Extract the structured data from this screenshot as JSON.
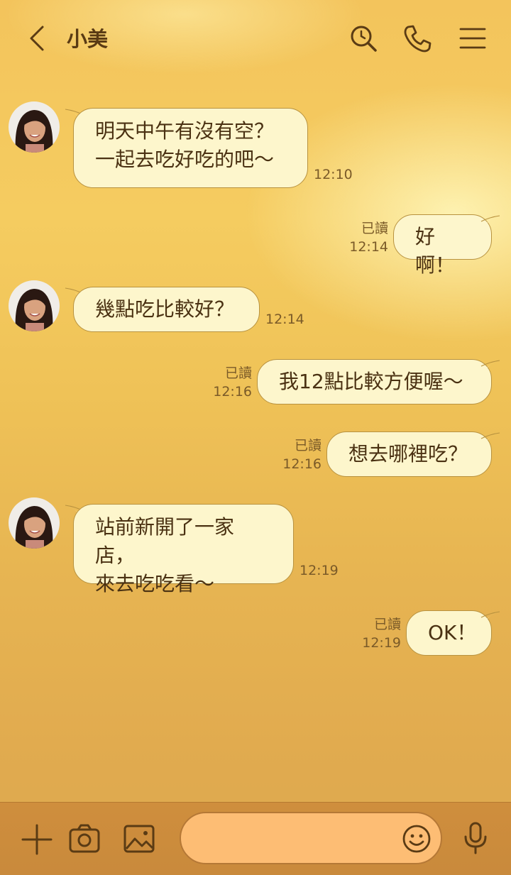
{
  "header": {
    "title": "小美"
  },
  "messages": [
    {
      "side": "in",
      "text": "明天中午有沒有空？\n一起去吃好吃的吧～",
      "time": "12:10"
    },
    {
      "side": "out",
      "text": "好啊！",
      "time": "12:14",
      "read": "已讀"
    },
    {
      "side": "in",
      "text": "幾點吃比較好？",
      "time": "12:14"
    },
    {
      "side": "out",
      "text": "我12點比較方便喔～",
      "time": "12:16",
      "read": "已讀"
    },
    {
      "side": "out",
      "text": "想去哪裡吃？",
      "time": "12:16",
      "read": "已讀"
    },
    {
      "side": "in",
      "text": "站前新開了一家店，\n來去吃吃看～",
      "time": "12:19"
    },
    {
      "side": "out",
      "text": "OK！",
      "time": "12:19",
      "read": "已讀"
    }
  ],
  "composer": {
    "placeholder": ""
  },
  "colors": {
    "bubble": "#fdf6cc",
    "bubble_border": "#b8923f",
    "text": "#5a3b14",
    "input": "#fdbd74"
  }
}
